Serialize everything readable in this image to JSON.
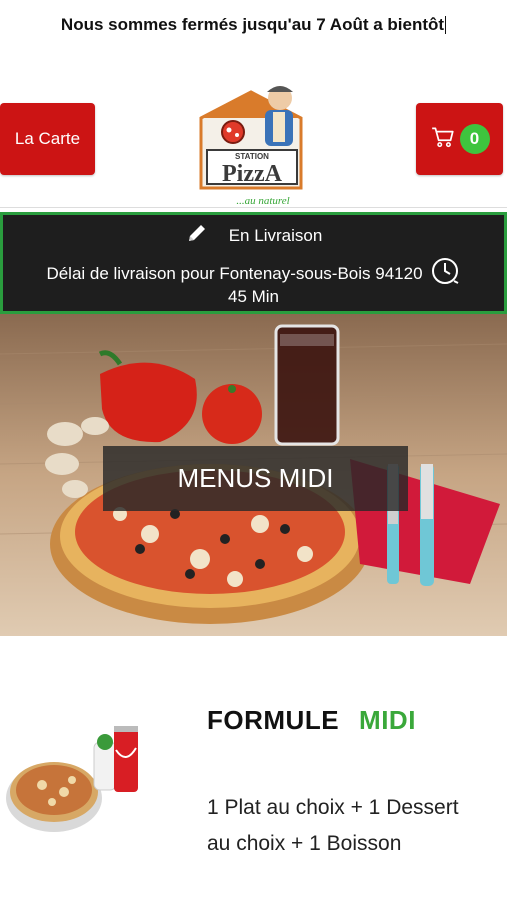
{
  "notice": {
    "text": "Nous sommes fermés jusqu'au 7 Août a bientôt"
  },
  "header": {
    "menu_button": "La Carte",
    "cart_count": "0",
    "logo": {
      "word_station": "STATION",
      "word_pizza": "PizzA",
      "tagline": "...au naturel"
    }
  },
  "delivery": {
    "mode": "En Livraison",
    "info": "Délai de livraison pour Fontenay-sous-Bois 94120",
    "time": "45 Min"
  },
  "hero": {
    "label": "MENUS MIDI"
  },
  "formule": {
    "title": "FORMULE",
    "title_highlight": "MIDI",
    "description": "1 Plat au choix + 1 Dessert au choix + 1 Boisson"
  },
  "colors": {
    "red": "#cc1414",
    "green": "#3aa83a",
    "dark": "#1e1e1e",
    "border_green": "#2a9d3e"
  },
  "icons": {
    "cart": "cart-icon",
    "edit": "pencil-icon",
    "clock": "clock-icon"
  }
}
